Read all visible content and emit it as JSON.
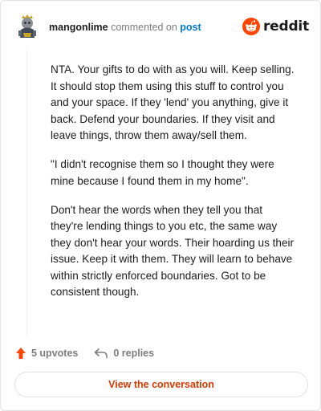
{
  "header": {
    "username": "mangonlime",
    "action_text": "commented on",
    "post_link": "post",
    "brand": "reddit",
    "avatar_icon": "snoo-avatar-icon",
    "brand_icon": "reddit-logo-icon"
  },
  "comment": {
    "paragraphs": [
      "NTA. Your gifts to do with as you will. Keep selling. It should stop them using this stuff to control you and your space. If they 'lend' you anything, give it back. Defend your boundaries. If they visit and leave things, throw them away/sell them.",
      "\"I didn't recognise them so I thought they were mine because I found them in my home\".",
      "Don't hear the words when they tell you that they're lending things to you etc, the same way they don't hear your words. Their hoarding us their issue. Keep it with them. They will learn to behave within strictly enforced boundaries. Got to be consistent though."
    ]
  },
  "actions": {
    "upvotes": "5 upvotes",
    "replies": "0 replies",
    "upvote_icon": "upvote-arrow-icon",
    "reply_icon": "reply-arrow-icon"
  },
  "footer": {
    "view_button": "View the conversation"
  },
  "colors": {
    "accent": "#d93a00",
    "link": "#0079d3",
    "reddit_orange": "#ff4500",
    "muted": "#7c7c7c"
  }
}
